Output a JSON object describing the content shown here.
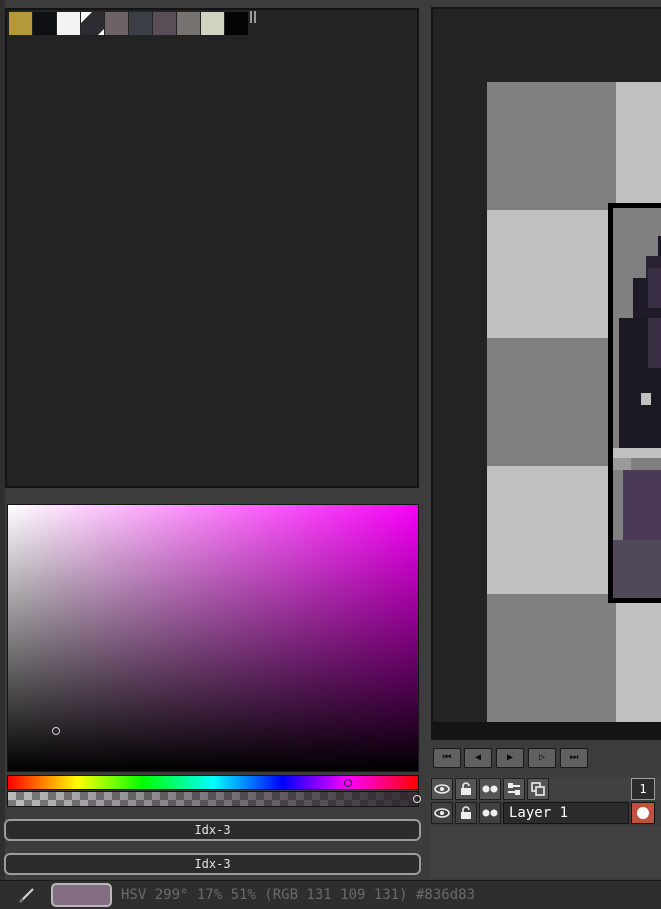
{
  "palette": {
    "swatches": [
      "#b5983c",
      "#0f1014",
      "#f3f3f3",
      "#2e2b33",
      "#6b6366",
      "#3c3e46",
      "#574e58",
      "#76726f",
      "#cfd3c0",
      "#040404"
    ]
  },
  "color_picker": {
    "hue_color": "#f800f8",
    "index_label_1": "Idx-3",
    "index_label_2": "Idx-3"
  },
  "timeline": {
    "buttons": [
      "⏮",
      "◀",
      "▶",
      "▷",
      "⏭"
    ],
    "frame_number": "1",
    "layer_name": "Layer 1"
  },
  "status": {
    "current_color": "#836d83",
    "text": "HSV 299° 17% 51% (RGB 131 109 131) #836d83"
  },
  "colors": {
    "panel_bg": "#232323",
    "app_bg": "#3c3c3c",
    "checker_dark": "#808080",
    "checker_light": "#c0c0c0",
    "cel_color": "#c34f3f"
  }
}
